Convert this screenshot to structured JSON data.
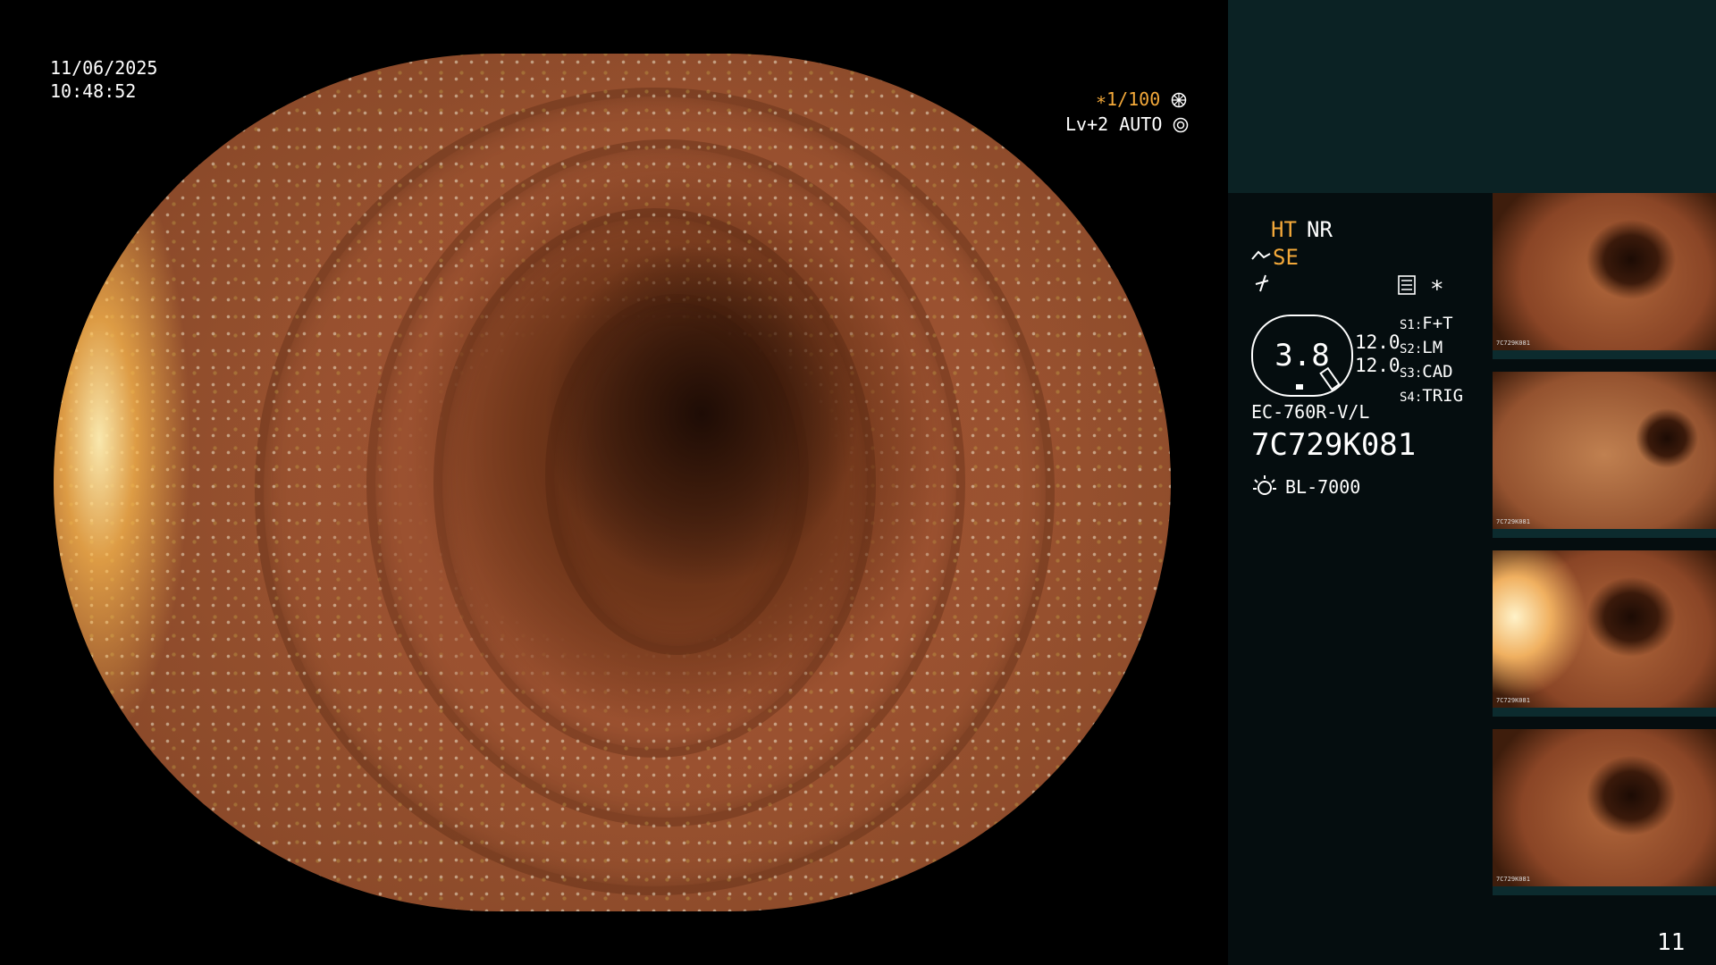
{
  "header": {
    "date": "11/06/2025",
    "time": "10:48:52"
  },
  "camera": {
    "shutter": "∗1/100",
    "shutter_icon": "aperture-icon",
    "level": "Lv+2 AUTO",
    "level_icon": "iris-icon"
  },
  "modes": {
    "ht": "HT",
    "nr": "NR",
    "se": "SE",
    "se_icon": "edge-enhance-icon",
    "freeze_icon": "freeze-icon",
    "settings_icon": "menu-icon",
    "star": "∗"
  },
  "gauge": {
    "value": "3.8",
    "left_top": "12.0",
    "left_bottom": "12.0"
  },
  "switches": [
    {
      "key": "S1",
      "value": "F+T"
    },
    {
      "key": "S2",
      "value": "LM"
    },
    {
      "key": "S3",
      "value": "CAD"
    },
    {
      "key": "S4",
      "value": "TRIG"
    }
  ],
  "scope": {
    "model": "EC-760R-V/L",
    "serial": "7C729K081"
  },
  "light": {
    "icon": "light-source-icon",
    "model": "BL-7000"
  },
  "thumbnails": [
    {
      "caption": "7C729K081"
    },
    {
      "caption": "7C729K081"
    },
    {
      "caption": "7C729K081"
    },
    {
      "caption": "7C729K081"
    }
  ],
  "page_number": "11",
  "colors": {
    "accent": "#f4a93a",
    "panel_top": "#0b2224",
    "panel": "#050d0f"
  }
}
